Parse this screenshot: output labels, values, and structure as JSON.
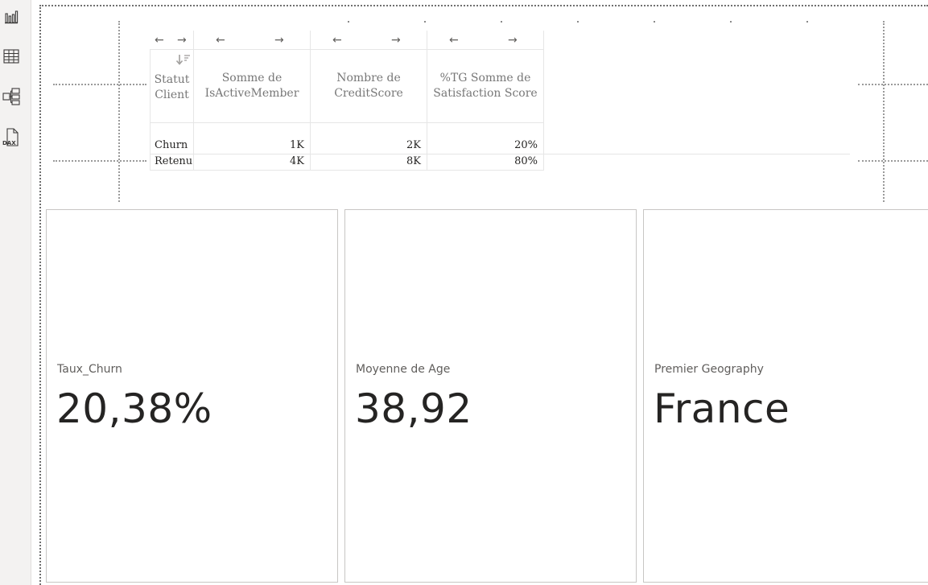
{
  "rail": {
    "items": [
      {
        "name": "report-view",
        "icon": "bar-chart-icon"
      },
      {
        "name": "table-view",
        "icon": "table-grid-icon"
      },
      {
        "name": "model-view",
        "icon": "model-icon"
      },
      {
        "name": "dax-query-view",
        "icon": "dax-icon",
        "badge": "DAX"
      }
    ]
  },
  "table": {
    "headers": [
      "Statut Client",
      "Somme de IsActiveMember",
      "Nombre de CreditScore",
      "%TG Somme de Satisfaction Score"
    ],
    "arrows": {
      "left": "←",
      "right": "→"
    },
    "sort_icon": "sort-descending-icon",
    "rows": [
      {
        "status": "Churn",
        "active": "1K",
        "credit": "2K",
        "satisfaction": "20%"
      },
      {
        "status": "Retenu",
        "active": "4K",
        "credit": "8K",
        "satisfaction": "80%"
      }
    ]
  },
  "cards": [
    {
      "label": "Taux_Churn",
      "value": "20,38%"
    },
    {
      "label": "Moyenne de Age",
      "value": "38,92"
    },
    {
      "label": "Premier Geography",
      "value": "France"
    }
  ],
  "colors": {
    "rail_bg": "#f3f2f1",
    "text_dark": "#252423",
    "text_muted": "#605e5c",
    "card_border": "#c8c6c4"
  }
}
